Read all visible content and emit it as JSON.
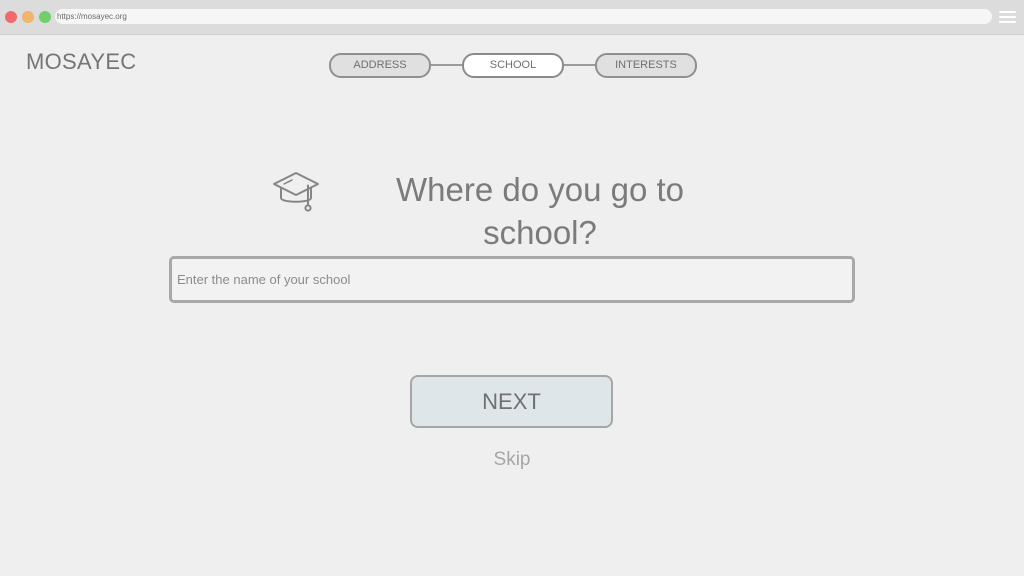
{
  "browser": {
    "url": "https://mosayec.org",
    "traffic_lights": {
      "close": "#ef6b6b",
      "minimize": "#f2b36a",
      "maximize": "#6fcf6a"
    }
  },
  "header": {
    "logo": "MOSAYEC"
  },
  "steps": [
    {
      "label": "ADDRESS",
      "active": false
    },
    {
      "label": "SCHOOL",
      "active": true
    },
    {
      "label": "INTERESTS",
      "active": false
    }
  ],
  "main": {
    "icon": "graduation-cap-icon",
    "question": "Where do you go to school?",
    "input": {
      "value": "",
      "placeholder": "Enter the name of your school"
    },
    "next_label": "NEXT",
    "skip_label": "Skip"
  },
  "colors": {
    "background": "#efefef",
    "next_button_bg": "#dfe6ea",
    "active_step_bg": "#ffffff",
    "inactive_step_bg": "#e0e0e0"
  }
}
